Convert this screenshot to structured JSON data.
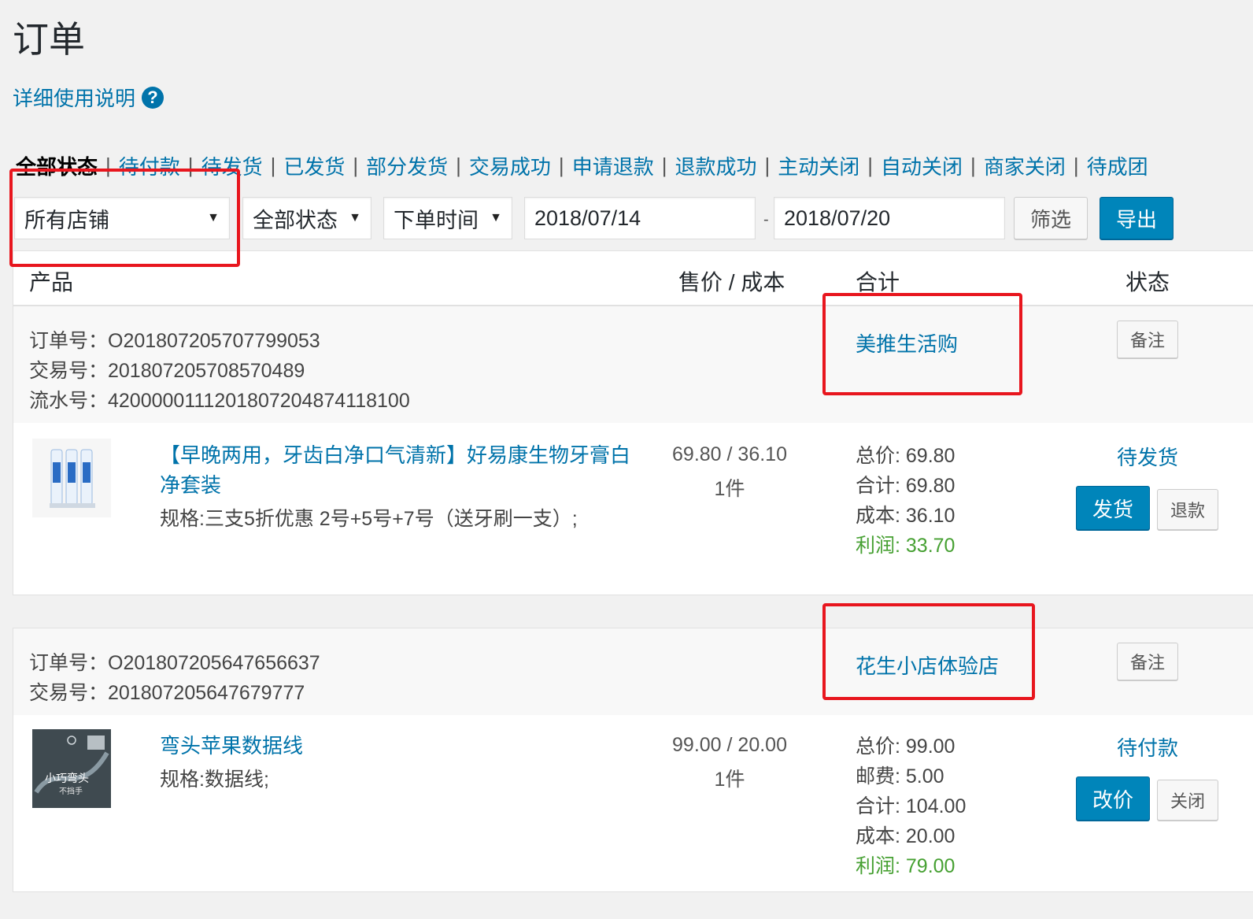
{
  "page": {
    "title": "订单",
    "help_link": "详细使用说明",
    "help_icon": "question-circle-icon"
  },
  "status_tabs": [
    {
      "label": "全部状态",
      "current": true
    },
    {
      "label": "待付款"
    },
    {
      "label": "待发货"
    },
    {
      "label": "已发货"
    },
    {
      "label": "部分发货"
    },
    {
      "label": "交易成功"
    },
    {
      "label": "申请退款"
    },
    {
      "label": "退款成功"
    },
    {
      "label": "主动关闭"
    },
    {
      "label": "自动关闭"
    },
    {
      "label": "商家关闭"
    },
    {
      "label": "待成团"
    }
  ],
  "filters": {
    "store_select": "所有店铺",
    "status_select": "全部状态",
    "time_select": "下单时间",
    "date_from": "2018/07/14",
    "date_separator": "-",
    "date_to": "2018/07/20",
    "filter_button": "筛选",
    "export_button": "导出",
    "colors": {
      "primary": "#0085ba",
      "link": "#0073aa",
      "profit": "#46a032",
      "highlight": "#e8161e"
    }
  },
  "table_header": {
    "product": "产品",
    "price_cost": "售价 / 成本",
    "total": "合计",
    "status": "状态"
  },
  "orders": [
    {
      "order_no": "订单号：O201807205707799053",
      "trade_no": "交易号：201807205708570489",
      "serial_no": "流水号：4200000111201807204874118100",
      "shop": "美推生活购",
      "note_button": "备注",
      "product_title": "【早晚两用，牙齿白净口气清新】好易康生物牙膏白净套装",
      "spec": "规格:三支5折优惠  2号+5号+7号（送牙刷一支）;",
      "price_cost": "69.80 / 36.10",
      "qty": "1件",
      "summary": [
        "总价: 69.80",
        "合计: 69.80",
        "成本: 36.10"
      ],
      "profit": "利润: 33.70",
      "status": "待发货",
      "primary_action": "发货",
      "secondary_action": "退款"
    },
    {
      "order_no": "订单号：O201807205647656637",
      "trade_no": "交易号：201807205647679777",
      "shop": "花生小店体验店",
      "note_button": "备注",
      "product_title": "弯头苹果数据线",
      "spec": "规格:数据线;",
      "price_cost": "99.00 / 20.00",
      "qty": "1件",
      "summary": [
        "总价: 99.00",
        "邮费: 5.00",
        "合计: 104.00",
        "成本: 20.00"
      ],
      "profit": "利润: 79.00",
      "status": "待付款",
      "primary_action": "改价",
      "secondary_action": "关闭",
      "thumb_text": "小巧弯头",
      "thumb_subtext": "不挡手"
    }
  ]
}
